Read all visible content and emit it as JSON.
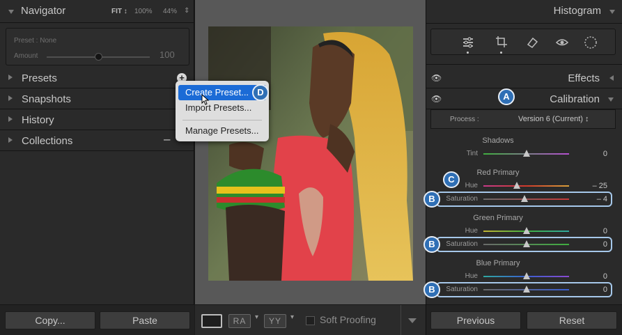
{
  "left": {
    "navigator": {
      "title": "Navigator",
      "fit": "FIT ↕",
      "zoom1": "100%",
      "zoom2": "44%"
    },
    "preset": {
      "label": "Preset : None",
      "amount_label": "Amount",
      "amount_value": "100"
    },
    "panels": [
      {
        "label": "Presets"
      },
      {
        "label": "Snapshots"
      },
      {
        "label": "History"
      },
      {
        "label": "Collections"
      }
    ],
    "copy": "Copy...",
    "paste": "Paste"
  },
  "menu": {
    "items": [
      "Create Preset...",
      "Import Presets...",
      "Manage Presets..."
    ]
  },
  "center": {
    "soft_proofing": "Soft Proofing",
    "compare1": "RA",
    "compare2": "YY"
  },
  "right": {
    "histogram": "Histogram",
    "effects": "Effects",
    "calibration": "Calibration",
    "process_label": "Process :",
    "process_value": "Version 6 (Current) ↕",
    "shadows": {
      "title": "Shadows",
      "tint_label": "Tint",
      "tint_value": "0",
      "tint_fraction": 0.5
    },
    "red": {
      "title": "Red Primary",
      "hue_label": "Hue",
      "hue_value": "– 25",
      "sat_label": "Saturation",
      "sat_value": "– 4"
    },
    "green": {
      "title": "Green Primary",
      "hue_label": "Hue",
      "hue_value": "0",
      "sat_label": "Saturation",
      "sat_value": "0"
    },
    "blue": {
      "title": "Blue Primary",
      "hue_label": "Hue",
      "hue_value": "0",
      "sat_label": "Saturation",
      "sat_value": "0"
    },
    "previous": "Previous",
    "reset": "Reset"
  },
  "badges": {
    "a": "A",
    "b": "B",
    "c": "C",
    "d": "D"
  },
  "colors": {
    "accent": "#2f6fb5",
    "highlight": "#a6c8ea",
    "menu_selected": "#1b6bd6"
  }
}
